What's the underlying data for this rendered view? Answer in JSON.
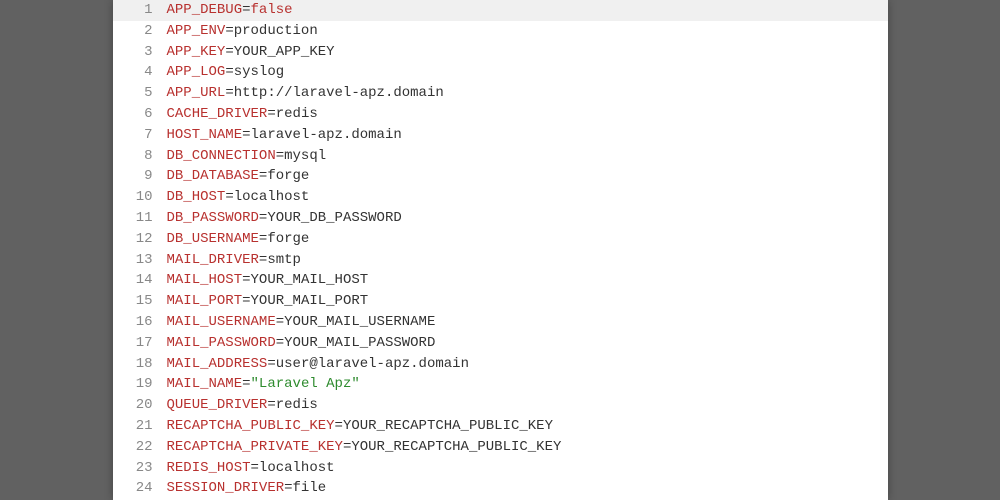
{
  "lines": [
    {
      "num": 1,
      "key": "APP_DEBUG",
      "value": "false",
      "valueClass": "keyword-false",
      "highlighted": true
    },
    {
      "num": 2,
      "key": "APP_ENV",
      "value": "production",
      "valueClass": "value"
    },
    {
      "num": 3,
      "key": "APP_KEY",
      "value": "YOUR_APP_KEY",
      "valueClass": "value"
    },
    {
      "num": 4,
      "key": "APP_LOG",
      "value": "syslog",
      "valueClass": "value"
    },
    {
      "num": 5,
      "key": "APP_URL",
      "value": "http://laravel-apz.domain",
      "valueClass": "value"
    },
    {
      "num": 6,
      "key": "CACHE_DRIVER",
      "value": "redis",
      "valueClass": "value"
    },
    {
      "num": 7,
      "key": "HOST_NAME",
      "value": "laravel-apz.domain",
      "valueClass": "value"
    },
    {
      "num": 8,
      "key": "DB_CONNECTION",
      "value": "mysql",
      "valueClass": "value"
    },
    {
      "num": 9,
      "key": "DB_DATABASE",
      "value": "forge",
      "valueClass": "value"
    },
    {
      "num": 10,
      "key": "DB_HOST",
      "value": "localhost",
      "valueClass": "value"
    },
    {
      "num": 11,
      "key": "DB_PASSWORD",
      "value": "YOUR_DB_PASSWORD",
      "valueClass": "value"
    },
    {
      "num": 12,
      "key": "DB_USERNAME",
      "value": "forge",
      "valueClass": "value"
    },
    {
      "num": 13,
      "key": "MAIL_DRIVER",
      "value": "smtp",
      "valueClass": "value"
    },
    {
      "num": 14,
      "key": "MAIL_HOST",
      "value": "YOUR_MAIL_HOST",
      "valueClass": "value"
    },
    {
      "num": 15,
      "key": "MAIL_PORT",
      "value": "YOUR_MAIL_PORT",
      "valueClass": "value"
    },
    {
      "num": 16,
      "key": "MAIL_USERNAME",
      "value": "YOUR_MAIL_USERNAME",
      "valueClass": "value"
    },
    {
      "num": 17,
      "key": "MAIL_PASSWORD",
      "value": "YOUR_MAIL_PASSWORD",
      "valueClass": "value"
    },
    {
      "num": 18,
      "key": "MAIL_ADDRESS",
      "value": "user@laravel-apz.domain",
      "valueClass": "value"
    },
    {
      "num": 19,
      "key": "MAIL_NAME",
      "value": "\"Laravel Apz\"",
      "valueClass": "string-quoted"
    },
    {
      "num": 20,
      "key": "QUEUE_DRIVER",
      "value": "redis",
      "valueClass": "value"
    },
    {
      "num": 21,
      "key": "RECAPTCHA_PUBLIC_KEY",
      "value": "YOUR_RECAPTCHA_PUBLIC_KEY",
      "valueClass": "value"
    },
    {
      "num": 22,
      "key": "RECAPTCHA_PRIVATE_KEY",
      "value": "YOUR_RECAPTCHA_PUBLIC_KEY",
      "valueClass": "value"
    },
    {
      "num": 23,
      "key": "REDIS_HOST",
      "value": "localhost",
      "valueClass": "value"
    },
    {
      "num": 24,
      "key": "SESSION_DRIVER",
      "value": "file",
      "valueClass": "value"
    }
  ]
}
